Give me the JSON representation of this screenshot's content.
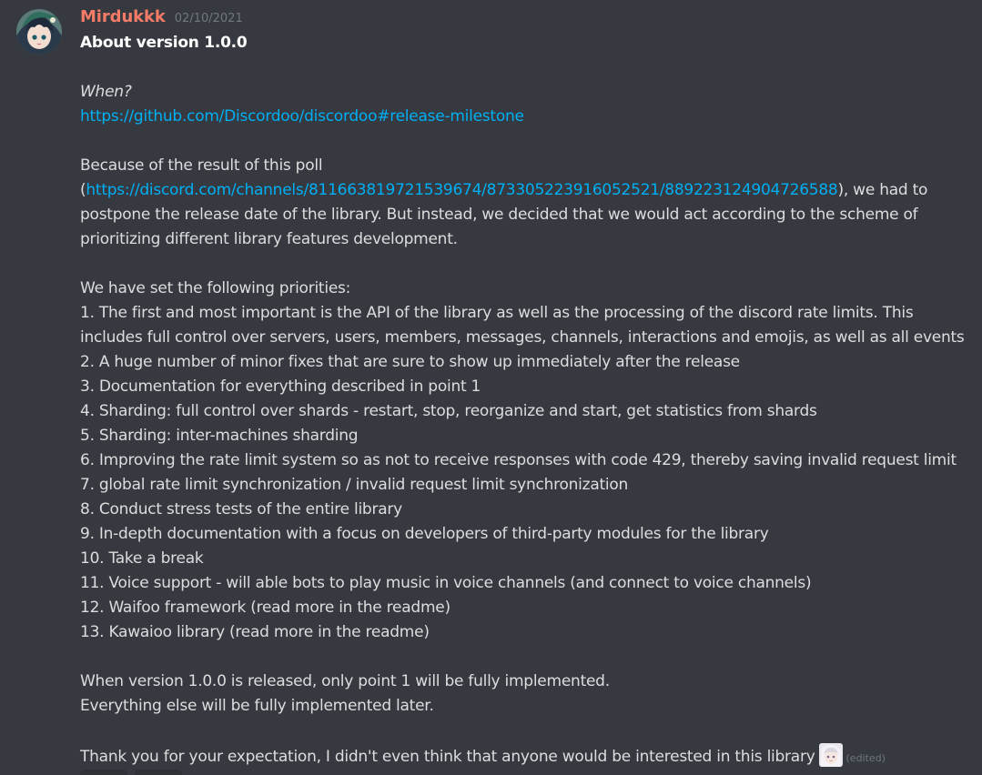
{
  "message": {
    "author": "Mirdukkk",
    "timestamp": "02/10/2021",
    "author_color": "#f47b67",
    "lines": {
      "title": "About version 1.0.0",
      "when": "When?",
      "milestone_link": "https://github.com/Discordoo/discordoo#release-milestone",
      "poll_intro": "Because of the result of this poll",
      "paren_open": "(",
      "poll_link": "https://discord.com/channels/811663819721539674/873305223916052521/889223124904726588",
      "poll_after": "), we had to",
      "postpone": "postpone the release date of the library. But instead, we decided that we would act according to the scheme of",
      "prioritizing": "prioritizing different library features development.",
      "priorities_intro": "We have set the following priorities:",
      "p1a": "1. The first and most important is the API of the library as well as the processing of the discord rate limits. This",
      "p1b": "includes full control over servers, users, members, messages, channels, interactions and emojis, as well as all events",
      "p2": "2. A huge number of minor fixes that are sure to show up immediately after the release",
      "p3": "3. Documentation for everything described in point 1",
      "p4": "4. Sharding: full control over shards - restart, stop, reorganize and start, get statistics from shards",
      "p5": "5. Sharding: inter-machines sharding",
      "p6": "6. Improving the rate limit system so as not to receive responses with code 429, thereby saving invalid request limit",
      "p7": "7. global rate limit synchronization / invalid request limit synchronization",
      "p8": "8. Conduct stress tests of the entire library",
      "p9": "9. In-depth documentation with a focus on developers of third-party modules for the library",
      "p10": "10. Take a break",
      "p11": "11. Voice support - will able bots to play music in voice channels (and connect to voice channels)",
      "p12": "12. Waifoo framework (read more in the readme)",
      "p13": "13. Kawaioo library (read more in the readme)",
      "release_note": "When version 1.0.0 is released, only point 1 will be fully implemented.",
      "later_note": "Everything else will be fully implemented later.",
      "thanks": "Thank you for your expectation, I didn't even think that anyone would be interested in this library",
      "edited": "(edited)"
    },
    "emoji_name": "anime-girl-emoji"
  },
  "colors": {
    "background": "#36393f",
    "text": "#dcddde",
    "link": "#00aff4",
    "muted": "#72767d"
  }
}
